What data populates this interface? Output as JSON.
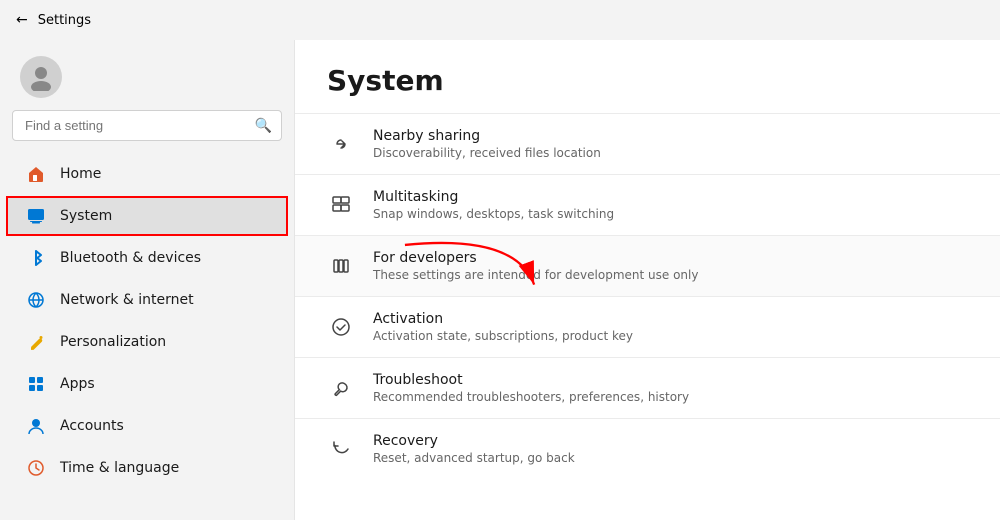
{
  "titlebar": {
    "back_label": "←",
    "title": "Settings"
  },
  "sidebar": {
    "search_placeholder": "Find a setting",
    "search_icon": "🔍",
    "nav_items": [
      {
        "id": "home",
        "label": "Home",
        "icon": "🏠",
        "icon_class": "icon-home",
        "active": false
      },
      {
        "id": "system",
        "label": "System",
        "icon": "🖥",
        "icon_class": "icon-system",
        "active": true
      },
      {
        "id": "bluetooth",
        "label": "Bluetooth & devices",
        "icon": "🔷",
        "icon_class": "icon-bluetooth",
        "active": false
      },
      {
        "id": "network",
        "label": "Network & internet",
        "icon": "🌐",
        "icon_class": "icon-network",
        "active": false
      },
      {
        "id": "personalization",
        "label": "Personalization",
        "icon": "🖊",
        "icon_class": "icon-personalization",
        "active": false
      },
      {
        "id": "apps",
        "label": "Apps",
        "icon": "📦",
        "icon_class": "icon-apps",
        "active": false
      },
      {
        "id": "accounts",
        "label": "Accounts",
        "icon": "👤",
        "icon_class": "icon-accounts",
        "active": false
      },
      {
        "id": "time",
        "label": "Time & language",
        "icon": "🕐",
        "icon_class": "icon-time",
        "active": false
      }
    ]
  },
  "content": {
    "title": "System",
    "items": [
      {
        "id": "nearby-sharing",
        "icon": "↔",
        "title": "Nearby sharing",
        "subtitle": "Discoverability, received files location"
      },
      {
        "id": "multitasking",
        "icon": "⊡",
        "title": "Multitasking",
        "subtitle": "Snap windows, desktops, task switching"
      },
      {
        "id": "for-developers",
        "icon": "⚙",
        "title": "For developers",
        "subtitle": "These settings are intended for development use only",
        "highlighted": true
      },
      {
        "id": "activation",
        "icon": "✓",
        "title": "Activation",
        "subtitle": "Activation state, subscriptions, product key"
      },
      {
        "id": "troubleshoot",
        "icon": "🔧",
        "title": "Troubleshoot",
        "subtitle": "Recommended troubleshooters, preferences, history"
      },
      {
        "id": "recovery",
        "icon": "⟳",
        "title": "Recovery",
        "subtitle": "Reset, advanced startup, go back"
      }
    ]
  }
}
